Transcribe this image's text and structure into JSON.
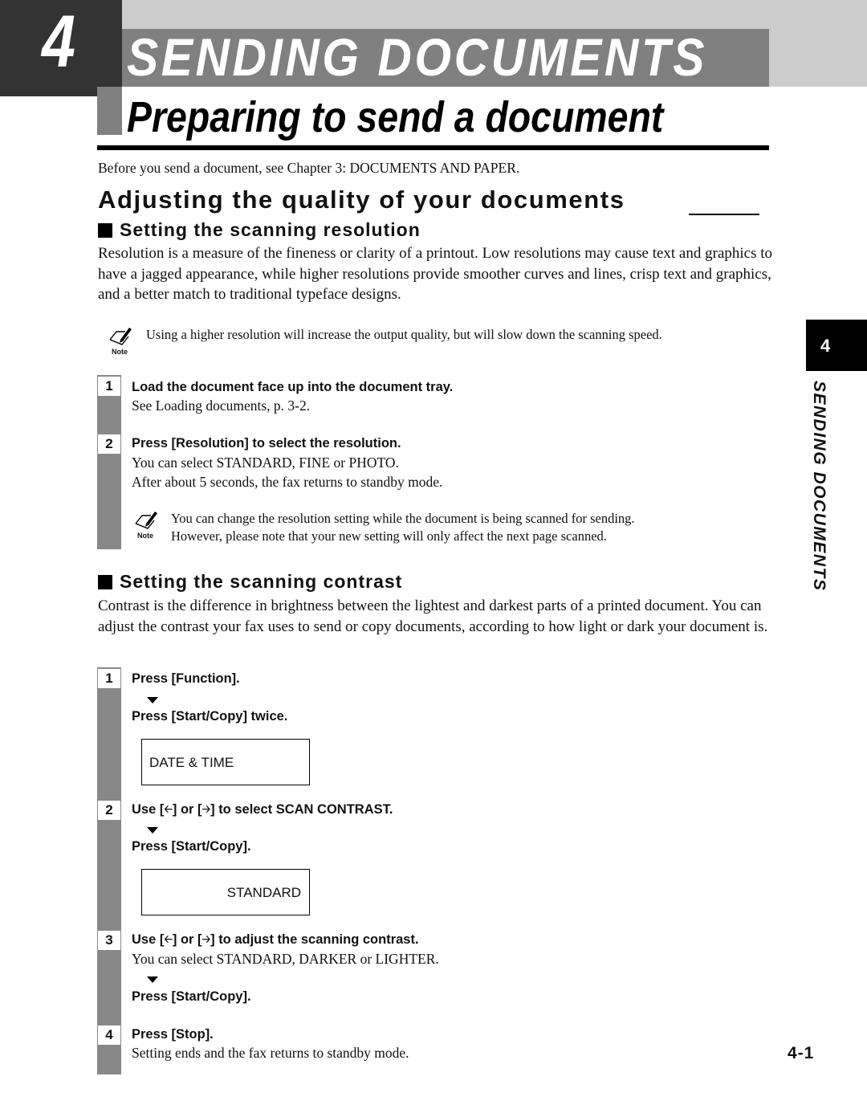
{
  "header": {
    "chapter_number": "4",
    "chapter_title": "SENDING DOCUMENTS",
    "page_title": "Preparing to send a document"
  },
  "intro": "Before you send a document, see Chapter 3: DOCUMENTS AND PAPER.",
  "section": {
    "heading": "Adjusting the quality of your documents",
    "resolution": {
      "heading": "Setting the scanning resolution",
      "paragraph": "Resolution is a measure of the fineness or clarity of a printout. Low resolutions may cause text and graphics to have a jagged appearance, while higher resolutions provide smoother curves and lines, crisp text and graphics, and a better match to traditional typeface designs.",
      "note": {
        "label": "Note",
        "text": "Using a higher resolution will increase the output quality, but will slow down the scanning speed."
      },
      "steps": [
        {
          "number": "1",
          "title": "Load the document face up into the document tray.",
          "body": [
            "See Loading documents, p. 3-2."
          ]
        },
        {
          "number": "2",
          "title": "Press [Resolution] to select the resolution.",
          "body": [
            "You can select STANDARD, FINE or PHOTO.",
            "After about 5 seconds, the fax returns to standby mode."
          ],
          "note": {
            "label": "Note",
            "lines": [
              "You can change the resolution setting while the document is being scanned for sending.",
              "However, please note that your new setting will only affect the next page scanned."
            ]
          }
        }
      ]
    },
    "contrast": {
      "heading": "Setting the scanning contrast",
      "paragraph": "Contrast is the difference in brightness between the lightest and darkest parts of a printed document. You can adjust the contrast your fax uses to send or copy documents, according to how light or dark your document is.",
      "steps": [
        {
          "number": "1",
          "title": "Press [Function].",
          "then": "Press [Start/Copy] twice.",
          "display": "DATE & TIME"
        },
        {
          "number": "2",
          "title_parts": [
            "Use [",
            "] or [",
            "] to select SCAN CONTRAST."
          ],
          "then": "Press [Start/Copy].",
          "display": "STANDARD"
        },
        {
          "number": "3",
          "title_parts": [
            "Use [",
            "] or [",
            "] to adjust the scanning contrast."
          ],
          "body": "You can select STANDARD, DARKER or LIGHTER.",
          "then": "Press [Start/Copy]."
        },
        {
          "number": "4",
          "title": "Press [Stop].",
          "body": "Setting ends and the fax returns to standby mode."
        }
      ]
    }
  },
  "side_tab": {
    "number": "4",
    "label": "SENDING DOCUMENTS"
  },
  "page_number": "4-1",
  "icons": {
    "left_arrow": "◆◀",
    "right_arrow": "▶"
  },
  "colors": {
    "header_dark": "#333333",
    "header_mid": "#808080",
    "header_light": "#cccccc",
    "step_bar": "#888888"
  }
}
